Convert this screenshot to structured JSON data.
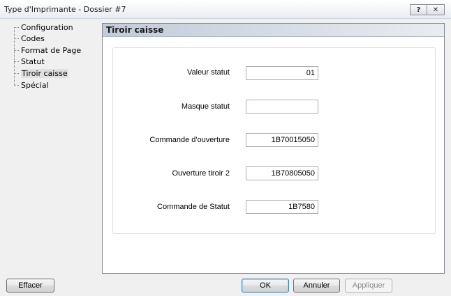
{
  "window": {
    "title": "Type d'Imprimante - Dossier #7",
    "help_label": "?",
    "close_label": "✕"
  },
  "tree": {
    "items": [
      {
        "label": "Configuration"
      },
      {
        "label": "Codes"
      },
      {
        "label": "Format de Page"
      },
      {
        "label": "Statut"
      },
      {
        "label": "Tiroir caisse",
        "selected": true
      },
      {
        "label": "Spécial"
      }
    ]
  },
  "panel": {
    "title": "Tiroir caisse",
    "fields": [
      {
        "label": "Valeur statut",
        "value": "01"
      },
      {
        "label": "Masque statut",
        "value": ""
      },
      {
        "label": "Commande d'ouverture",
        "value": "1B70015050"
      },
      {
        "label": "Ouverture tiroir 2",
        "value": "1B70805050"
      },
      {
        "label": "Commande de Statut",
        "value": "1B7580"
      }
    ]
  },
  "buttons": {
    "effacer": "Effacer",
    "ok": "OK",
    "annuler": "Annuler",
    "appliquer": "Appliquer"
  }
}
